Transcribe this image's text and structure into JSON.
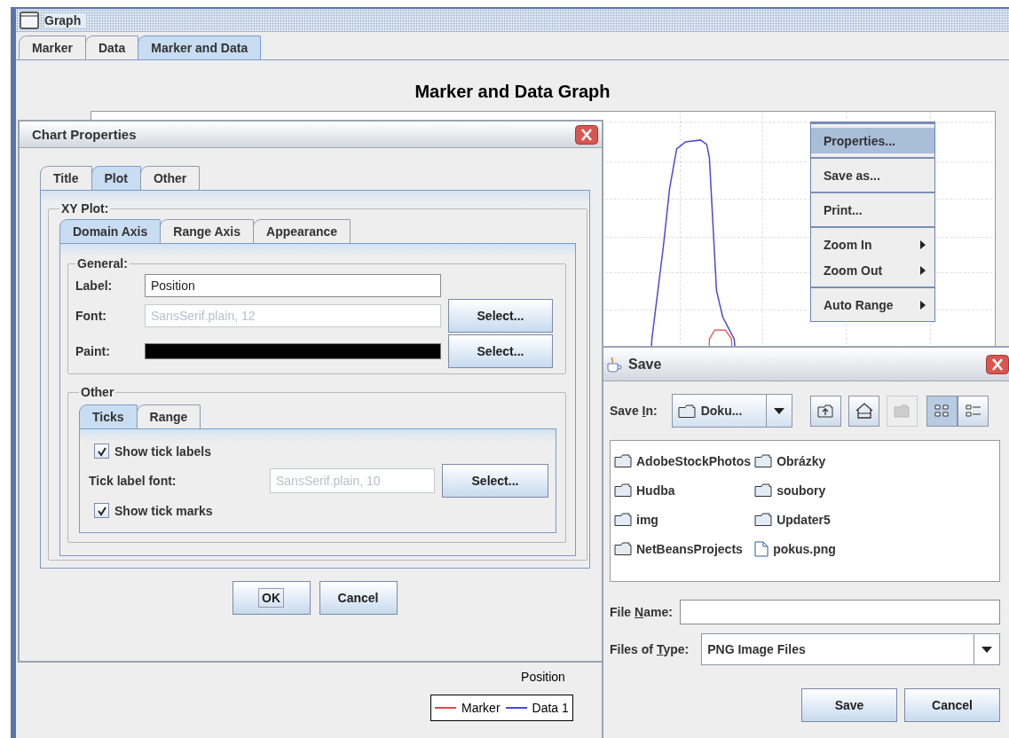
{
  "window": {
    "title": "Graph"
  },
  "tabs": [
    {
      "label": "Marker",
      "selected": false
    },
    {
      "label": "Data",
      "selected": false
    },
    {
      "label": "Marker and Data",
      "selected": true
    }
  ],
  "graph": {
    "title": "Marker and Data Graph",
    "axis_label": "Position",
    "legend": [
      {
        "label": "Marker",
        "color": "#e04848"
      },
      {
        "label": "Data 1",
        "color": "#4a4ad8"
      }
    ]
  },
  "chart_properties": {
    "title": "Chart Properties",
    "tabs": [
      {
        "label": "Title",
        "selected": false
      },
      {
        "label": "Plot",
        "selected": true
      },
      {
        "label": "Other",
        "selected": false
      }
    ],
    "group_title": "XY Plot:",
    "axis_tabs": [
      {
        "label": "Domain Axis",
        "selected": true
      },
      {
        "label": "Range Axis",
        "selected": false
      },
      {
        "label": "Appearance",
        "selected": false
      }
    ],
    "general": {
      "title": "General:",
      "label": {
        "label": "Label:",
        "value": "Position",
        "disabled": false
      },
      "font": {
        "label": "Font:",
        "value": "SansSerif.plain, 12",
        "disabled": true,
        "button": "Select..."
      },
      "paint": {
        "label": "Paint:",
        "color": "#000000",
        "button": "Select..."
      }
    },
    "other": {
      "title": "Other",
      "tabs": [
        {
          "label": "Ticks",
          "selected": true
        },
        {
          "label": "Range",
          "selected": false
        }
      ],
      "show_tick_labels": {
        "label": "Show tick labels",
        "checked": true
      },
      "tick_label_font": {
        "label": "Tick label font:",
        "value": "SansSerif.plain, 10",
        "disabled": true,
        "button": "Select..."
      },
      "show_tick_marks": {
        "label": "Show tick marks",
        "checked": true
      }
    },
    "buttons": [
      {
        "label": "OK",
        "default": true
      },
      {
        "label": "Cancel",
        "default": false
      }
    ]
  },
  "context_menu": {
    "groups": [
      [
        {
          "label": "Properties...",
          "selected": true,
          "submenu": false
        }
      ],
      [
        {
          "label": "Save as...",
          "selected": false,
          "submenu": false
        }
      ],
      [
        {
          "label": "Print...",
          "selected": false,
          "submenu": false
        }
      ],
      [
        {
          "label": "Zoom In",
          "selected": false,
          "submenu": true
        },
        {
          "label": "Zoom Out",
          "selected": false,
          "submenu": true
        }
      ],
      [
        {
          "label": "Auto Range",
          "selected": false,
          "submenu": true
        }
      ]
    ]
  },
  "save_dialog": {
    "title": "Save",
    "save_in": {
      "label_parts": [
        "Save ",
        "I",
        "n:"
      ],
      "value": "Doku..."
    },
    "tool_buttons": [
      {
        "kind": "up",
        "disabled": false,
        "selected": false
      },
      {
        "kind": "home",
        "disabled": false,
        "selected": false
      },
      {
        "kind": "new_folder",
        "disabled": true,
        "selected": false
      },
      {
        "kind": "list",
        "disabled": false,
        "selected": true
      },
      {
        "kind": "details",
        "disabled": false,
        "selected": false
      }
    ],
    "files": [
      {
        "name": "AdobeStockPhotos",
        "kind": "folder"
      },
      {
        "name": "Hudba",
        "kind": "folder"
      },
      {
        "name": "img",
        "kind": "folder"
      },
      {
        "name": "NetBeansProjects",
        "kind": "folder"
      },
      {
        "name": "Obrázky",
        "kind": "folder"
      },
      {
        "name": "soubory",
        "kind": "folder"
      },
      {
        "name": "Updater5",
        "kind": "folder"
      },
      {
        "name": "pokus.png",
        "kind": "file"
      }
    ],
    "file_name": {
      "label_parts": [
        "File ",
        "N",
        "ame:"
      ]
    },
    "file_type": {
      "label_parts": [
        "Files of ",
        "T",
        "ype:"
      ],
      "value": "PNG Image Files"
    },
    "buttons": [
      "Save",
      "Cancel"
    ]
  }
}
